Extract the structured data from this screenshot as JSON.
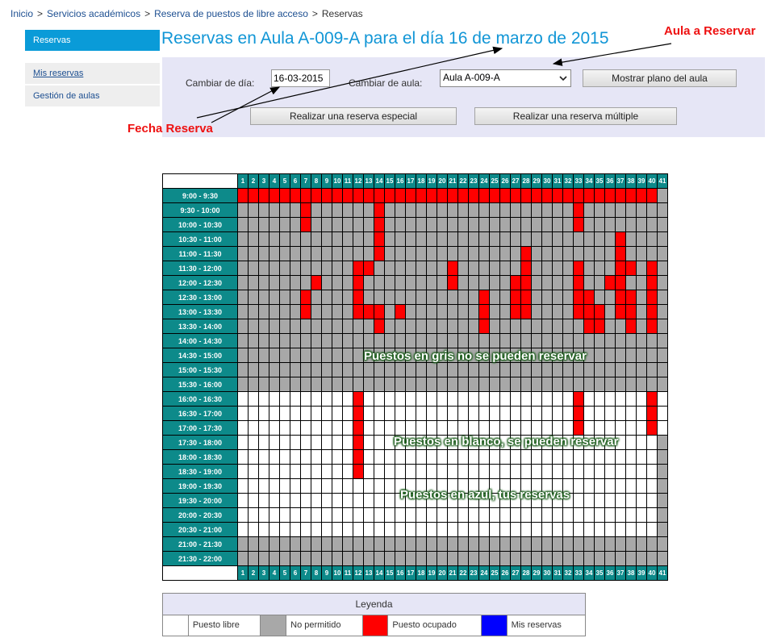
{
  "breadcrumb": {
    "items": [
      "Inicio",
      "Servicios académicos",
      "Reserva de puestos de libre acceso",
      "Reservas"
    ],
    "sep": ">"
  },
  "sidebar": {
    "active": "Reservas",
    "items": [
      {
        "label": "Mis reservas"
      },
      {
        "label": "Gestión de aulas"
      }
    ]
  },
  "page_title": "Reservas en Aula A-009-A para el día 16 de marzo de 2015",
  "form": {
    "date_label": "Cambiar de día:",
    "date_value": "16-03-2015",
    "room_label": "Cambiar de aula:",
    "room_value": "Aula A-009-A",
    "show_map_button": "Mostrar plano del aula",
    "special_button": "Realizar una reserva especial",
    "multiple_button": "Realizar una reserva múltiple"
  },
  "annotations": {
    "room": "Aula a Reservar",
    "date": "Fecha Reserva",
    "gray_note": "Puestos en gris no se pueden reservar",
    "white_note": "Puestos en blanco, se pueden reservar",
    "blue_note": "Puestos en azul, tus reservas"
  },
  "colors": {
    "free": "#ffffff",
    "not_allowed": "#a8a8a8",
    "occupied": "#ff0000",
    "mine": "#0000ff",
    "header": "#0d8a8a",
    "accent": "#0a9bd8"
  },
  "grid": {
    "seats": [
      1,
      2,
      3,
      4,
      5,
      6,
      7,
      8,
      9,
      10,
      11,
      12,
      13,
      14,
      15,
      16,
      17,
      18,
      19,
      20,
      21,
      22,
      23,
      24,
      25,
      26,
      27,
      28,
      29,
      30,
      31,
      32,
      33,
      34,
      35,
      36,
      37,
      38,
      39,
      40,
      41
    ],
    "legend_codes": {
      "0": "Puesto libre",
      "1": "No permitido",
      "2": "Puesto ocupado",
      "3": "Mis reservas"
    },
    "slots": [
      {
        "time": "9:00 - 9:30",
        "cells": "22222222222222222222222222222222222222221"
      },
      {
        "time": "9:30 - 10:00",
        "cells": "11111121111112111111111111111111211111111"
      },
      {
        "time": "10:00 - 10:30",
        "cells": "11111121111112111111111111111111211111111"
      },
      {
        "time": "10:30 - 11:00",
        "cells": "11111111111112111111111111111111111121111"
      },
      {
        "time": "11:00 - 11:30",
        "cells": "11111111111112111111111111121111111121111"
      },
      {
        "time": "11:30 - 12:00",
        "cells": "11111111111221111111211111121111211122121"
      },
      {
        "time": "12:00 - 12:30",
        "cells": "11111112111211111111211111221111211221121"
      },
      {
        "time": "12:30 - 13:00",
        "cells": "11111121111211111111111211221111221122121"
      },
      {
        "time": "13:00 - 13:30",
        "cells": "11111121111222121111111211221111222122121"
      },
      {
        "time": "13:30 - 14:00",
        "cells": "11111111111112111111111211111111122112121"
      },
      {
        "time": "14:00 - 14:30",
        "cells": "11111111111111111111111111111111111111111"
      },
      {
        "time": "14:30 - 15:00",
        "cells": "11111111111111111111111111111111111111111"
      },
      {
        "time": "15:00 - 15:30",
        "cells": "11111111111111111111111111111111111111111"
      },
      {
        "time": "15:30 - 16:00",
        "cells": "11111111111111111111111111111111111111111"
      },
      {
        "time": "16:00 - 16:30",
        "cells": "00000000000200000000000000000000200000020"
      },
      {
        "time": "16:30 - 17:00",
        "cells": "00000000000200000000000000000000200000020"
      },
      {
        "time": "17:00 - 17:30",
        "cells": "00000000000200000000000000000000200000020"
      },
      {
        "time": "17:30 - 18:00",
        "cells": "00000000000200000000000000000000000000001"
      },
      {
        "time": "18:00 - 18:30",
        "cells": "00000000000200000000000000000000000000001"
      },
      {
        "time": "18:30 - 19:00",
        "cells": "00000000000200000000000000000000000000001"
      },
      {
        "time": "19:00 - 19:30",
        "cells": "00000000000000000000000000000000000000001"
      },
      {
        "time": "19:30 - 20:00",
        "cells": "00000000000000000000000000000000000000001"
      },
      {
        "time": "20:00 - 20:30",
        "cells": "00000000000000000000000000000000000000001"
      },
      {
        "time": "20:30 - 21:00",
        "cells": "00000000000000000000000000000000000000001"
      },
      {
        "time": "21:00 - 21:30",
        "cells": "11111111111111111111111111111111111111111"
      },
      {
        "time": "21:30 - 22:00",
        "cells": "11111111111111111111111111111111111111111"
      }
    ]
  },
  "legend": {
    "title": "Leyenda",
    "items": [
      {
        "label": "Puesto libre",
        "color": "#ffffff"
      },
      {
        "label": "No permitido",
        "color": "#a8a8a8"
      },
      {
        "label": "Puesto ocupado",
        "color": "#ff0000"
      },
      {
        "label": "Mis reservas",
        "color": "#0000ff"
      }
    ]
  }
}
